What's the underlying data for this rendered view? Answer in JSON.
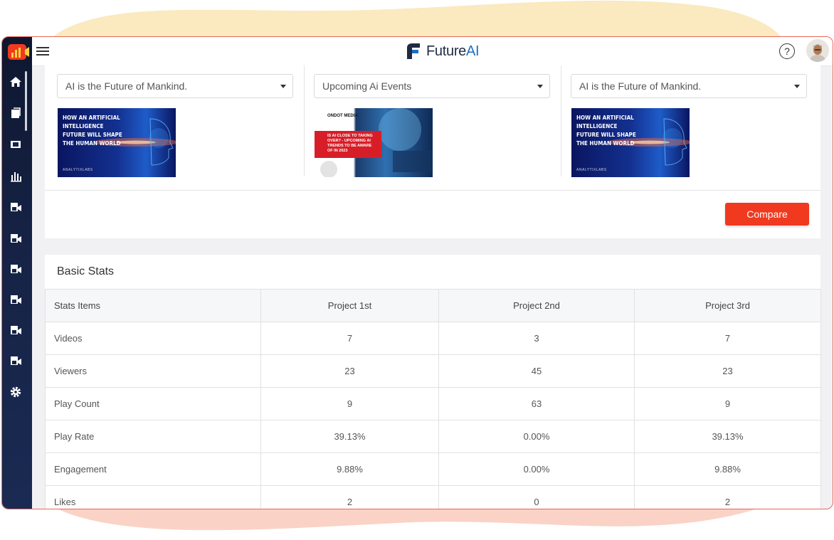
{
  "colors": {
    "accent": "#f0391f",
    "sidebar": "#162346",
    "brand_blue": "#1e6fbf"
  },
  "header": {
    "brand_prefix": "Future",
    "brand_suffix": "AI",
    "help_symbol": "?"
  },
  "projects": [
    {
      "select_value": "AI is the Future of Mankind.",
      "thumb_title": "HOW AN ARTIFICIAL INTELLIGENCE FUTURE WILL SHAPE THE HUMAN WORLD",
      "thumb_brand": "ANALYTIXLABS"
    },
    {
      "select_value": "Upcoming Ai Events",
      "thumb_title": "IS AI CLOSE TO TAKING OVER? - UPCOMING AI TRENDS TO BE AWARE OF IN 2023",
      "thumb_brand": "ONDOT MEDIA"
    },
    {
      "select_value": "AI is the Future of Mankind.",
      "thumb_title": "HOW AN ARTIFICIAL INTELLIGENCE FUTURE WILL SHAPE THE HUMAN WORLD",
      "thumb_brand": "ANALYTIXLABS"
    }
  ],
  "compare_label": "Compare",
  "stats": {
    "title": "Basic Stats",
    "headers": [
      "Stats Items",
      "Project 1st",
      "Project 2nd",
      "Project 3rd"
    ],
    "rows": [
      [
        "Videos",
        "7",
        "3",
        "7"
      ],
      [
        "Viewers",
        "23",
        "45",
        "23"
      ],
      [
        "Play Count",
        "9",
        "63",
        "9"
      ],
      [
        "Play Rate",
        "39.13%",
        "0.00%",
        "39.13%"
      ],
      [
        "Engagement",
        "9.88%",
        "0.00%",
        "9.88%"
      ],
      [
        "Likes",
        "2",
        "0",
        "2"
      ]
    ]
  }
}
